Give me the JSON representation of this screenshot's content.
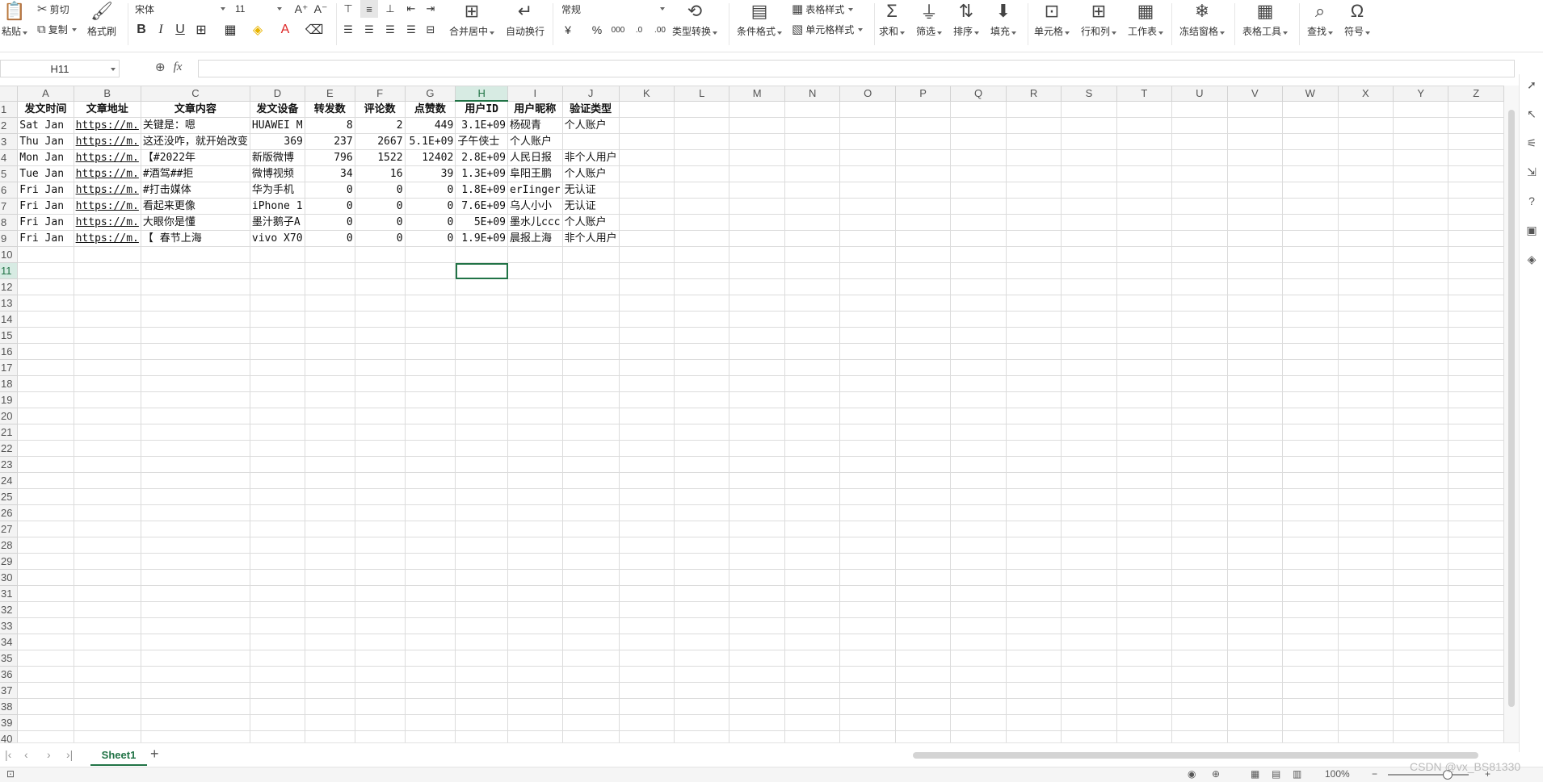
{
  "ribbon": {
    "paste": "粘贴",
    "cut": "剪切",
    "copy": "复制",
    "format_painter": "格式刷",
    "font_name": "宋体",
    "font_size": "11",
    "number_format": "常规",
    "merge_center": "合并居中",
    "wrap_text": "自动换行",
    "type_convert": "类型转换",
    "table_style": "表格样式",
    "conditional_format": "条件格式",
    "cell_style": "单元格样式",
    "sum": "求和",
    "filter": "筛选",
    "sort": "排序",
    "fill": "填充",
    "cell": "单元格",
    "row_col": "行和列",
    "worksheet": "工作表",
    "freeze": "冻结窗格",
    "table_tools": "表格工具",
    "find": "查找",
    "symbol": "符号"
  },
  "formula_bar": {
    "name_box": "H11",
    "fx_label": "fx",
    "formula": ""
  },
  "columns": [
    "A",
    "B",
    "C",
    "D",
    "E",
    "F",
    "G",
    "H",
    "I",
    "J",
    "K",
    "L",
    "M",
    "N",
    "O",
    "P",
    "Q",
    "R",
    "S",
    "T",
    "U",
    "V",
    "W",
    "X",
    "Y",
    "Z"
  ],
  "selected_column": "H",
  "selected_row": 11,
  "header_row": [
    "发文时间",
    "文章地址",
    "文章内容",
    "发文设备",
    "转发数",
    "评论数",
    "点赞数",
    "用户ID",
    "用户昵称",
    "验证类型"
  ],
  "rows": [
    [
      "Sat Jan",
      "https://m.",
      "关键是：嗯",
      "HUAWEI M",
      "8",
      "2",
      "449",
      "3.1E+09",
      "杨砚青",
      "个人账户"
    ],
    [
      "Thu Jan",
      "https://m.",
      "这还没咋，就开始改变",
      "369",
      "237",
      "2667",
      "5.1E+09",
      "子午侠士",
      "个人账户"
    ],
    [
      "Mon Jan",
      "https://m.",
      "【#2022年",
      "新版微博",
      "796",
      "1522",
      "12402",
      "2.8E+09",
      "人民日报",
      "非个人用户"
    ],
    [
      "Tue Jan",
      "https://m.",
      "#酒驾##拒",
      "微博视频",
      "34",
      "16",
      "39",
      "1.3E+09",
      "阜阳王鹏",
      "个人账户"
    ],
    [
      "Fri Jan",
      "https://m.",
      "#打击媒体",
      "华为手机",
      "0",
      "0",
      "0",
      "1.8E+09",
      "erIinger",
      "无认证"
    ],
    [
      "Fri Jan",
      "https://m.",
      "看起来更像",
      "iPhone 1",
      "0",
      "0",
      "0",
      "7.6E+09",
      "乌人小小",
      "无认证"
    ],
    [
      "Fri Jan",
      "https://m.",
      "大眼你是懂",
      "墨汁鹅子A",
      "0",
      "0",
      "0",
      "5E+09",
      "墨水儿ccc",
      "个人账户"
    ],
    [
      "Fri Jan",
      "https://m.",
      "【 春节上海",
      "vivo X70",
      "0",
      "0",
      "0",
      "1.9E+09",
      "晨报上海",
      "非个人用户"
    ]
  ],
  "total_rows": 43,
  "sheet_tab": "Sheet1",
  "status": {
    "zoom": "100%",
    "watermark": "CSDN @vx_BS81330"
  },
  "colors": {
    "accent": "#217346",
    "link": "#1a5fb4"
  }
}
